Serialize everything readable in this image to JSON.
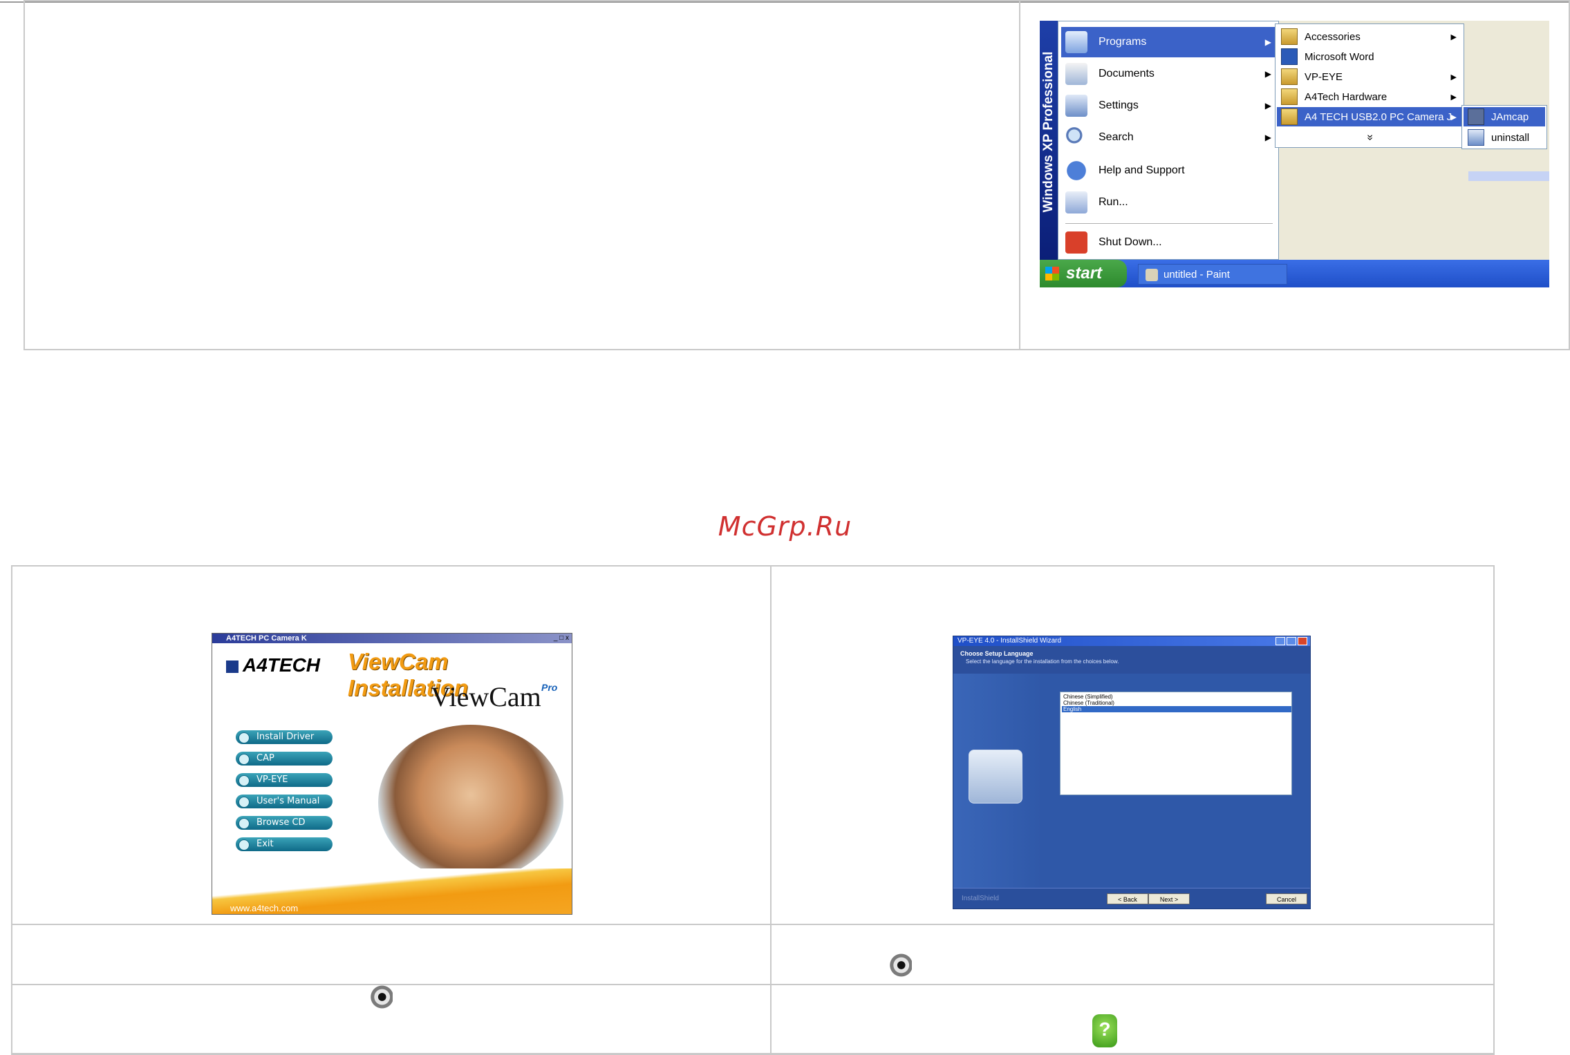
{
  "startmenu": {
    "os_label": "Windows XP Professional",
    "items": [
      {
        "label": "Programs",
        "icon": "programs-folder-icon"
      },
      {
        "label": "Documents",
        "icon": "documents-icon"
      },
      {
        "label": "Settings",
        "icon": "settings-icon"
      },
      {
        "label": "Search",
        "icon": "search-icon"
      },
      {
        "label": "Help and Support",
        "icon": "help-icon"
      },
      {
        "label": "Run...",
        "icon": "run-icon"
      },
      {
        "label": "Shut Down...",
        "icon": "shutdown-icon"
      }
    ],
    "programs_submenu": [
      "Accessories",
      "Microsoft Word",
      "VP-EYE",
      "A4Tech Hardware",
      "A4 TECH USB2.0 PC Camera J"
    ],
    "expand_glyph": "»",
    "camera_submenu": [
      "JAmcap",
      "uninstall"
    ],
    "start_label": "start",
    "task_label": "untitled - Paint"
  },
  "watermark": "McGrp.Ru",
  "a4tech": {
    "window_title": "A4TECH  PC  Camera  K",
    "win_buttons": "_ □ x",
    "logo": "A4TECH",
    "heading": "ViewCam Installation",
    "brand": "ViewCam",
    "brand_suffix": "Pro",
    "buttons": [
      "Install Driver",
      "CAP",
      "VP-EYE",
      "User's Manual",
      "Browse CD",
      "Exit"
    ],
    "url": "www.a4tech.com"
  },
  "installshield": {
    "window_title": "VP-EYE 4.0 - InstallShield Wizard",
    "heading": "Choose Setup Language",
    "subheading": "Select the language for the installation from the choices below.",
    "languages": [
      "Chinese (Simplified)",
      "Chinese (Traditional)",
      "English"
    ],
    "selected_language": "English",
    "brand": "InstallShield",
    "back_label": "< Back",
    "next_label": "Next >",
    "cancel_label": "Cancel"
  },
  "colors": {
    "menu_highlight": "#3b62c8",
    "taskbar": "#2856d6",
    "start_button": "#3a9a3a",
    "accent_orange": "#f29b12",
    "watermark": "#d03030"
  }
}
